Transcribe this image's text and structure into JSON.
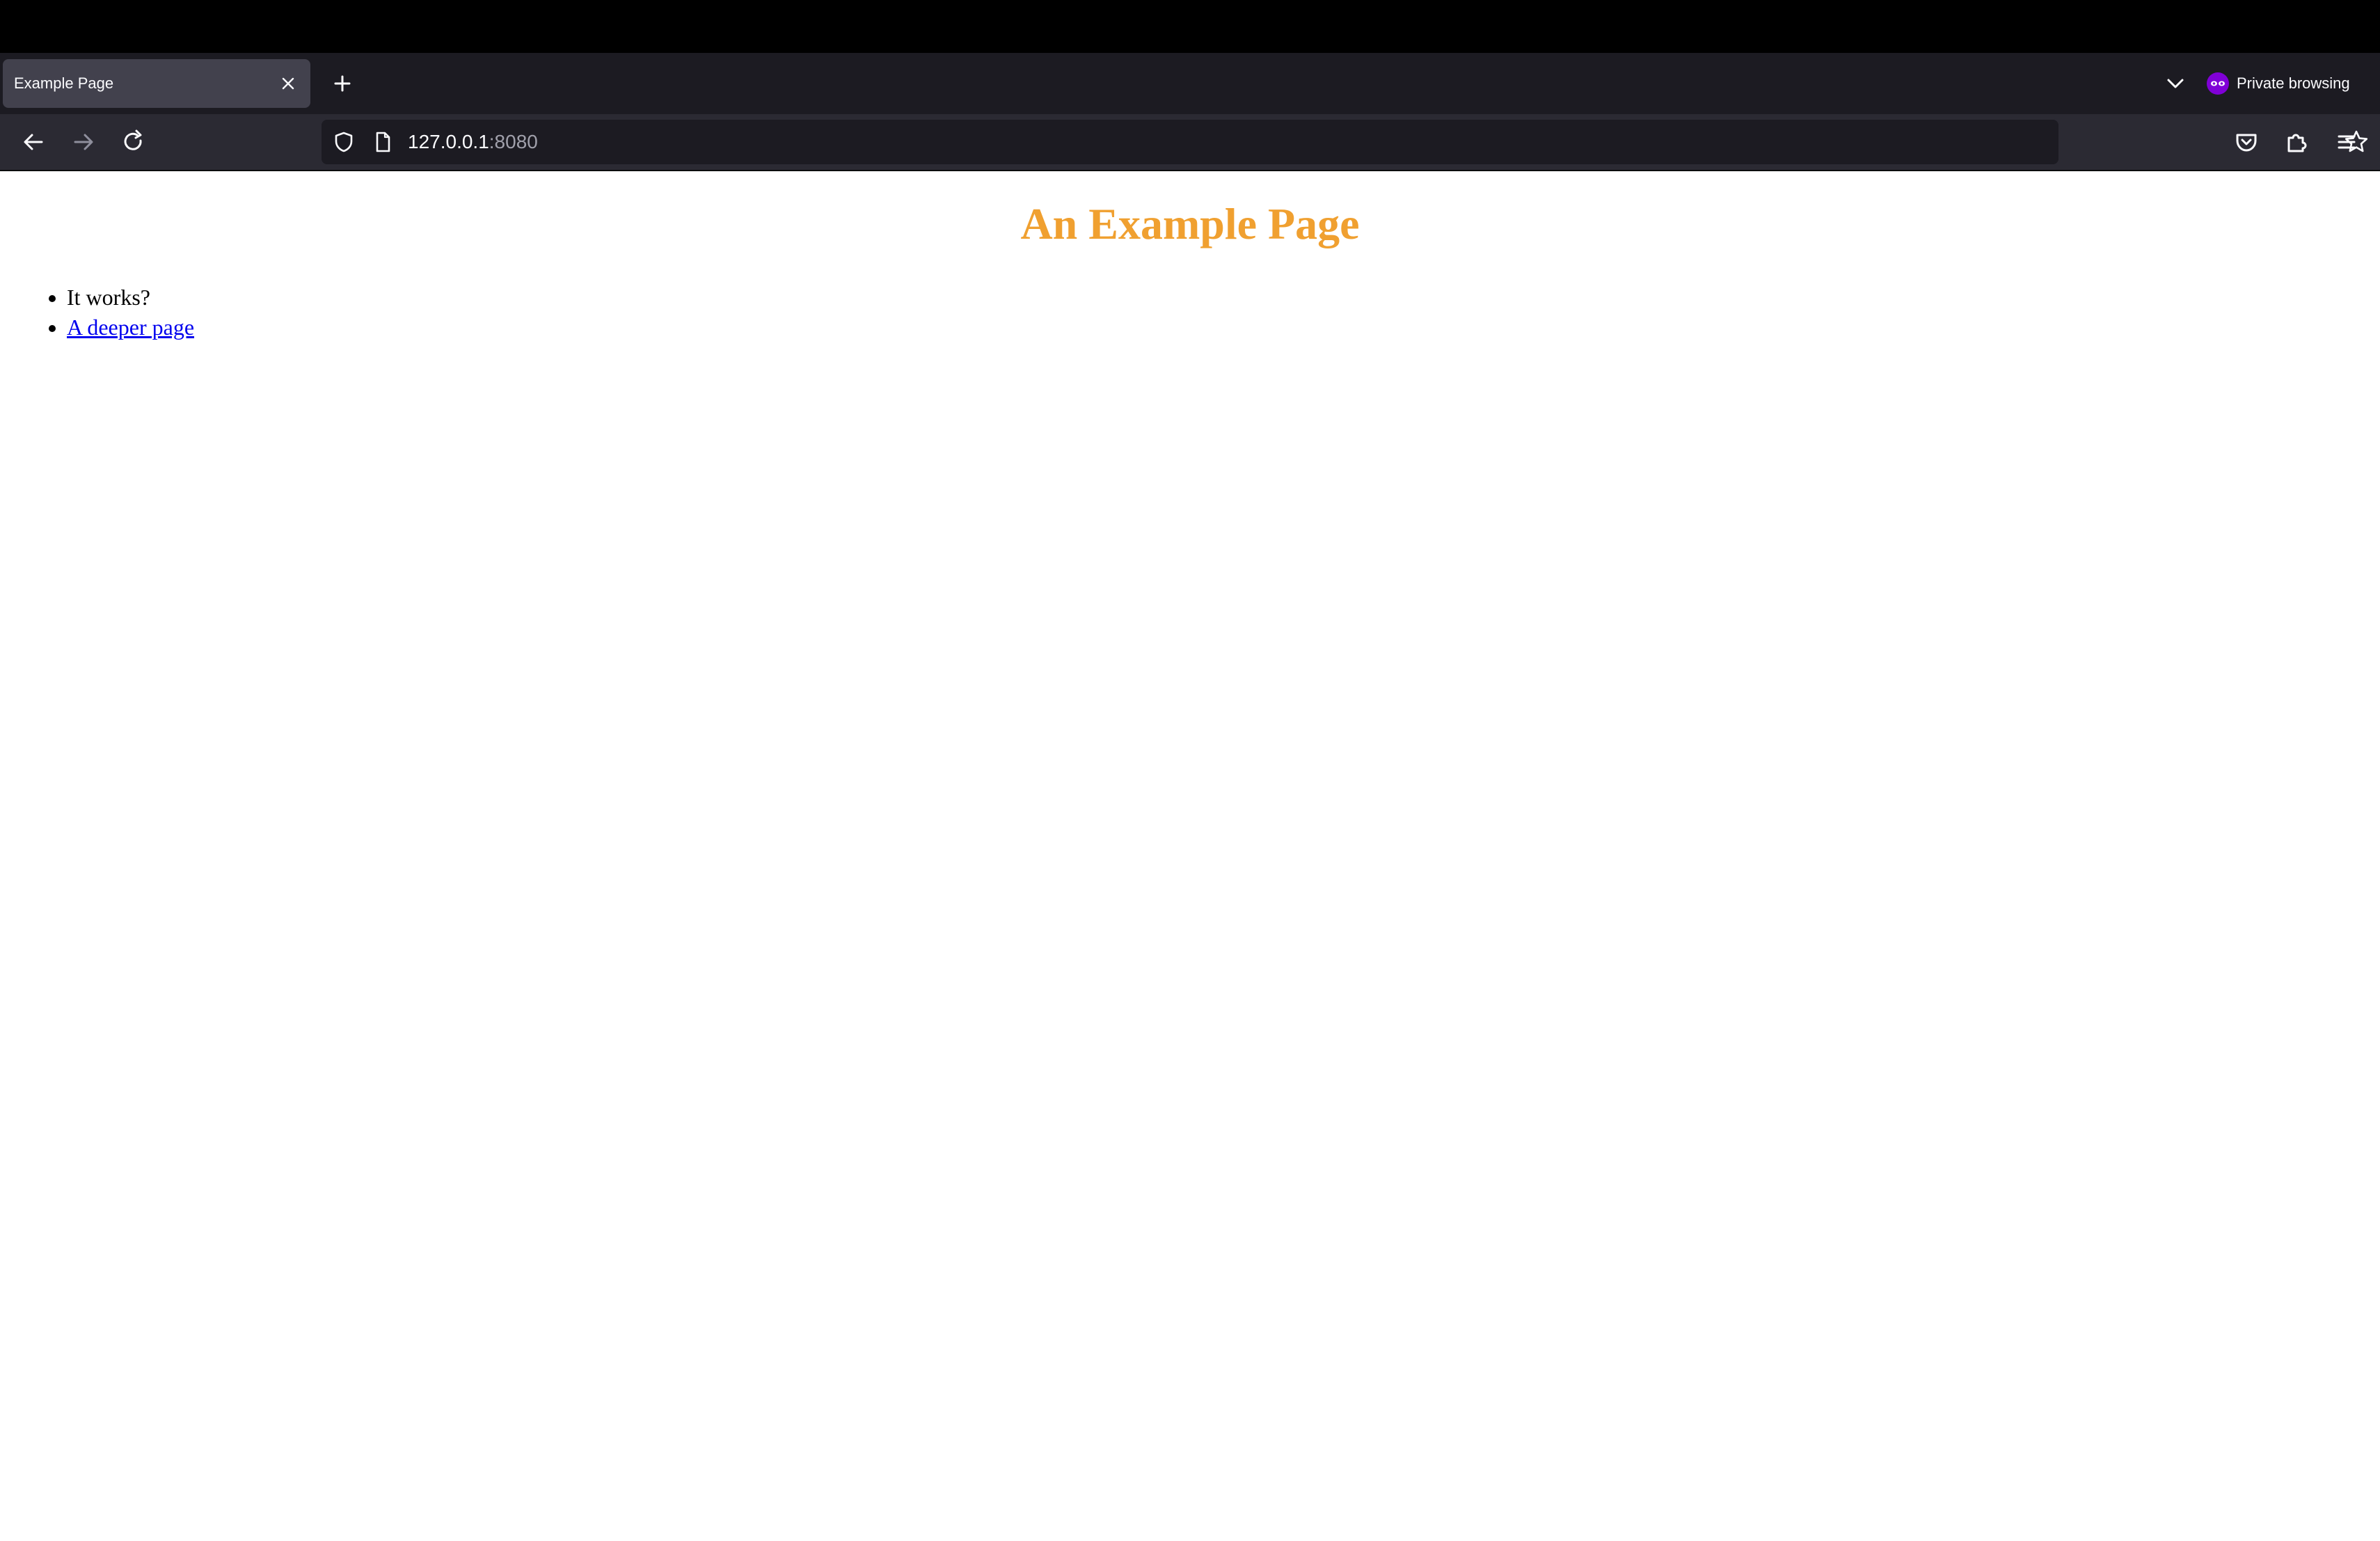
{
  "browser": {
    "tab": {
      "title": "Example Page"
    },
    "private_label": "Private browsing",
    "url": {
      "host": "127.0.0.1",
      "port": ":8080"
    }
  },
  "page": {
    "heading": "An Example Page",
    "items": [
      {
        "text": "It works?"
      },
      {
        "text": "A deeper page"
      }
    ]
  },
  "colors": {
    "heading": "#f0a030",
    "link": "#0000ee",
    "private_accent": "#8000d7",
    "chrome_dark": "#1c1b22",
    "toolbar": "#2b2a33"
  },
  "icons": {
    "tab_close": "close-icon",
    "new_tab": "plus-icon",
    "list_tabs": "chevron-down-icon",
    "private": "private-mask-icon",
    "back": "arrow-left-icon",
    "forward": "arrow-right-icon",
    "reload": "reload-icon",
    "security": "shield-icon",
    "page_info": "page-icon",
    "bookmark": "star-icon",
    "pocket": "pocket-icon",
    "extensions": "puzzle-icon",
    "menu": "hamburger-icon"
  }
}
